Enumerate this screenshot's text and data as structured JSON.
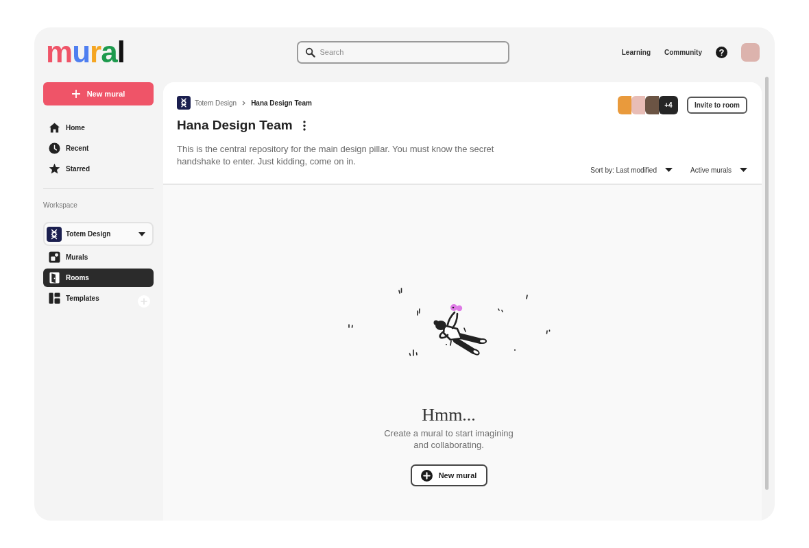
{
  "header": {
    "logo": "mural",
    "search": {
      "placeholder": "Search"
    },
    "links": [
      "Learning",
      "Community"
    ]
  },
  "sidebar": {
    "new_button": "New mural",
    "nav": [
      {
        "label": "Home",
        "selected": false
      },
      {
        "label": "Recent",
        "selected": false
      },
      {
        "label": "Starred",
        "selected": false
      }
    ],
    "workspace_label": "Workspace",
    "workspace": {
      "name": "Totem Design"
    },
    "workspace_items": [
      {
        "label": "Murals",
        "selected": false
      },
      {
        "label": "Rooms",
        "selected": true
      },
      {
        "label": "Templates",
        "selected": false
      }
    ]
  },
  "room": {
    "breadcrumb": [
      "Totem Design",
      "Hana Design Team"
    ],
    "title": "Hana Design Team",
    "description": "This is the central repository for the main design pillar. You must know the secret handshake to enter. Just kidding, come on in.",
    "members_more": "+4",
    "invite_button": "Invite to room",
    "sort": "Sort by: Last modified",
    "filter": "Active murals"
  },
  "empty_state": {
    "title": "Hmm...",
    "message": "Create a mural to start imagining and collaborating.",
    "button": "New mural"
  }
}
